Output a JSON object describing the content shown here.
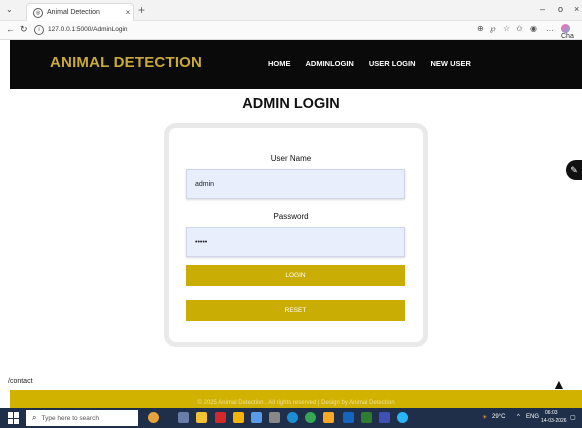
{
  "browser": {
    "tab_title": "Animal Detection",
    "tab_close": "×",
    "new_tab": "+",
    "url": "127.0.0.1:5000/AdminLogin",
    "profile_label": "Cha",
    "window_controls": {
      "minimize": "–",
      "maximize": "o",
      "close": "×"
    }
  },
  "site": {
    "logo": "ANIMAL DETECTION",
    "nav": [
      {
        "label": "HOME"
      },
      {
        "label": "ADMINLOGIN"
      },
      {
        "label": "USER LOGIN"
      },
      {
        "label": "NEW USER"
      }
    ]
  },
  "login": {
    "title": "ADMIN LOGIN",
    "username_label": "User Name",
    "username_value": "admin",
    "password_label": "Password",
    "password_value": "•••••",
    "login_button": "LOGIN",
    "reset_button": "RESET"
  },
  "status_url": "/contact",
  "footer": {
    "copyright": "© 2025 Animal Detection . All rights reserved | Design by Animal Detection"
  },
  "taskbar": {
    "search_placeholder": "Type here to search",
    "temperature": "29°C",
    "language": "ENG",
    "time": "06:03",
    "date": "14-03-2026"
  },
  "colors": {
    "accent": "#c9ad05",
    "header_bg": "#0a0a0a",
    "logo": "#c9a93a",
    "input_bg": "#e8eefc"
  }
}
